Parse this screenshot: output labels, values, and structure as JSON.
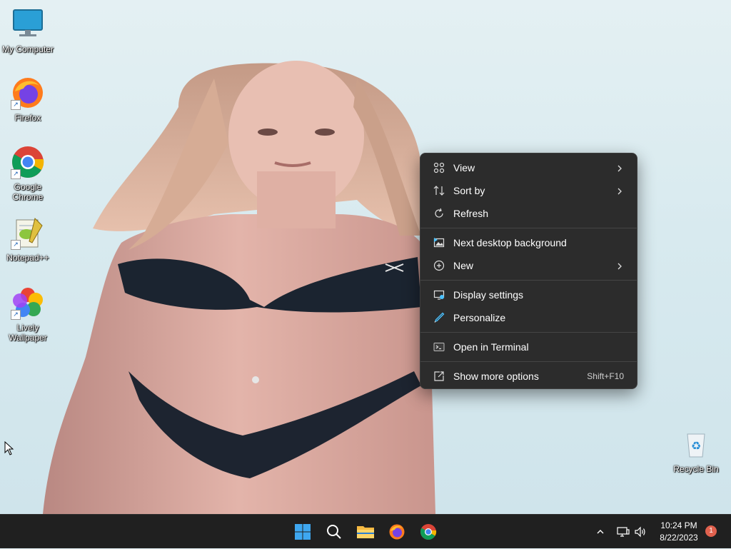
{
  "desktop": {
    "icons": [
      {
        "label": "My Computer"
      },
      {
        "label": "Firefox"
      },
      {
        "label": "Google Chrome"
      },
      {
        "label": "Notepad++"
      },
      {
        "label": "Lively Wallpaper"
      },
      {
        "label": "Recycle Bin"
      }
    ]
  },
  "context_menu": {
    "items": [
      {
        "label": "View",
        "icon": "grid-icon",
        "submenu": true
      },
      {
        "label": "Sort by",
        "icon": "sort-icon",
        "submenu": true
      },
      {
        "label": "Refresh",
        "icon": "refresh-icon"
      },
      {
        "label": "Next desktop background",
        "icon": "next-background-icon"
      },
      {
        "label": "New",
        "icon": "plus-circle-icon",
        "submenu": true
      },
      {
        "label": "Display settings",
        "icon": "display-icon"
      },
      {
        "label": "Personalize",
        "icon": "brush-icon"
      },
      {
        "label": "Open in Terminal",
        "icon": "terminal-icon"
      },
      {
        "label": "Show more options",
        "icon": "share-icon",
        "shortcut": "Shift+F10"
      }
    ]
  },
  "taskbar": {
    "pinned": [
      "start-button",
      "search-button",
      "file-explorer-button",
      "firefox-button",
      "chrome-button"
    ],
    "clock": {
      "time": "10:24 PM",
      "date": "8/22/2023"
    },
    "notification_count": "1"
  },
  "colors": {
    "menu_bg": "#2c2c2c",
    "taskbar_bg": "#202020",
    "accent": "#4cc2ff",
    "badge": "#e0614e"
  }
}
